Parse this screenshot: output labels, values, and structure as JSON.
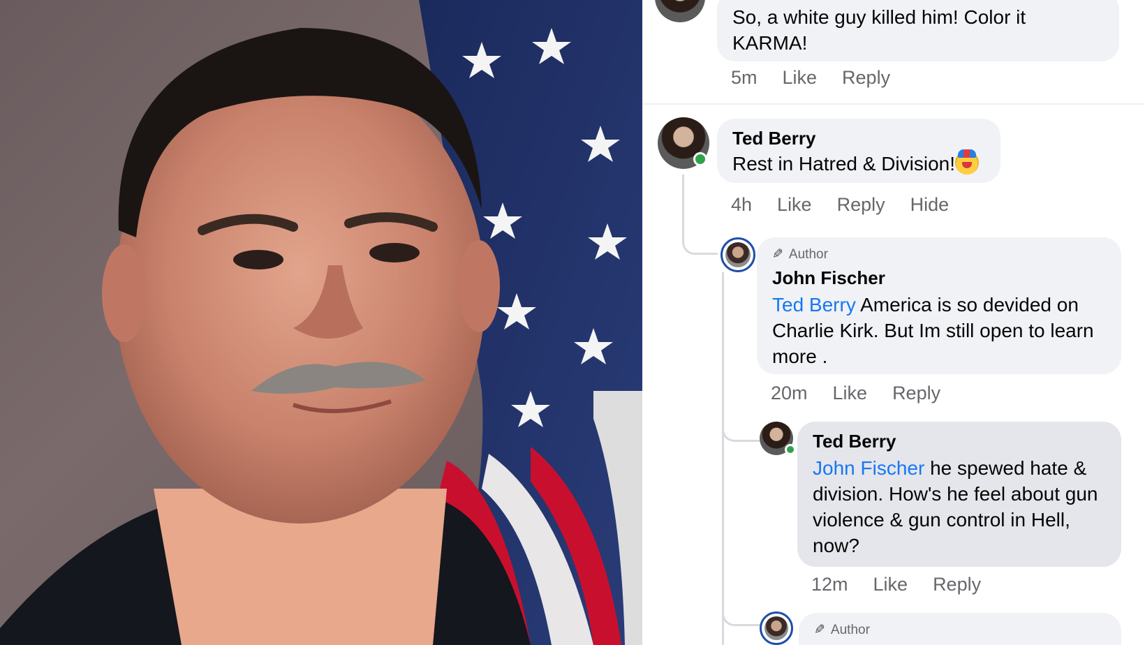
{
  "photo": {
    "description_icon": "portrait-photo"
  },
  "comments": [
    {
      "text": "So, a white guy killed him! Color it KARMA!",
      "time": "5m",
      "like": "Like",
      "reply": "Reply"
    },
    {
      "name": "Ted Berry",
      "text": "Rest in Hatred & Division!",
      "emoji": "clown-face-icon",
      "time": "4h",
      "like": "Like",
      "reply": "Reply",
      "hide": "Hide"
    },
    {
      "badge": "Author",
      "name": "John Fischer",
      "mention": "Ted Berry",
      "text": " America is so devided on Charlie Kirk. But Im still open to learn more .",
      "time": "20m",
      "like": "Like",
      "reply": "Reply"
    },
    {
      "name": "Ted Berry",
      "mention": "John Fischer",
      "text": " he spewed hate & division. How's he feel about gun violence & gun control in Hell, now?",
      "time": "12m",
      "like": "Like",
      "reply": "Reply"
    },
    {
      "badge": "Author"
    }
  ],
  "colors": {
    "mention": "#1877f2",
    "online": "#31a24c",
    "meta": "#65676b",
    "bubble": "#f0f2f5"
  }
}
